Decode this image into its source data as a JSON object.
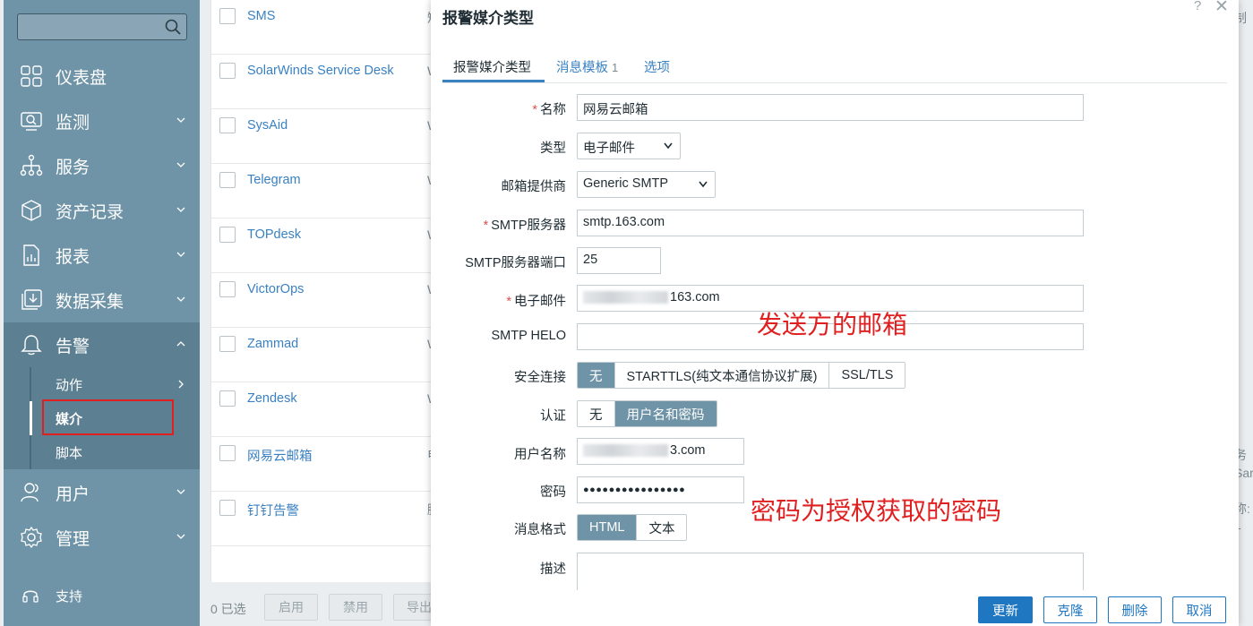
{
  "sidebar": {
    "search_placeholder": "",
    "items": [
      {
        "label": "仪表盘",
        "icon": "dashboard-icon"
      },
      {
        "label": "监测",
        "icon": "monitoring-icon"
      },
      {
        "label": "服务",
        "icon": "services-icon"
      },
      {
        "label": "资产记录",
        "icon": "inventory-icon"
      },
      {
        "label": "报表",
        "icon": "reports-icon"
      },
      {
        "label": "数据采集",
        "icon": "data-collection-icon"
      },
      {
        "label": "告警",
        "icon": "alerts-bell-icon"
      },
      {
        "label": "用户",
        "icon": "users-icon"
      },
      {
        "label": "管理",
        "icon": "administration-gear-icon"
      }
    ],
    "alerts_submenu": [
      {
        "label": "动作"
      },
      {
        "label": "媒介"
      },
      {
        "label": "脚本"
      }
    ],
    "support_label": "支持"
  },
  "list": {
    "rows": [
      {
        "name": "SMS",
        "type": "短"
      },
      {
        "name": "SolarWinds Service Desk",
        "type": "W"
      },
      {
        "name": "SysAid",
        "type": "W"
      },
      {
        "name": "Telegram",
        "type": "W"
      },
      {
        "name": "TOPdesk",
        "type": "W"
      },
      {
        "name": "VictorOps",
        "type": "W"
      },
      {
        "name": "Zammad",
        "type": "W"
      },
      {
        "name": "Zendesk",
        "type": "W"
      },
      {
        "name": "网易云邮箱",
        "type": "电"
      },
      {
        "name": "钉钉告警",
        "type": "脚"
      }
    ],
    "selected_count": "0 已选",
    "footer_buttons": [
      "启用",
      "禁用",
      "导出"
    ],
    "right_clip": [
      "制",
      "务",
      "Sar",
      "称: 1"
    ]
  },
  "modal": {
    "title": "报警媒介类型",
    "help": "?",
    "close": "✕",
    "tabs": [
      {
        "label": "报警媒介类型",
        "badge": ""
      },
      {
        "label": "消息模板",
        "badge": "1"
      },
      {
        "label": "选项",
        "badge": ""
      }
    ],
    "fields": {
      "name_label": "名称",
      "name_value": "网易云邮箱",
      "type_label": "类型",
      "type_value": "电子邮件",
      "provider_label": "邮箱提供商",
      "provider_value": "Generic SMTP",
      "smtp_server_label": "SMTP服务器",
      "smtp_server_value": "smtp.163.com",
      "smtp_port_label": "SMTP服务器端口",
      "smtp_port_value": "25",
      "email_label": "电子邮件",
      "email_value": "163.com",
      "helo_label": "SMTP HELO",
      "helo_value": "",
      "security_label": "安全连接",
      "security_options": [
        "无",
        "STARTTLS(纯文本通信协议扩展)",
        "SSL/TLS"
      ],
      "auth_label": "认证",
      "auth_options": [
        "无",
        "用户名和密码"
      ],
      "username_label": "用户名称",
      "username_value": "3.com",
      "password_label": "密码",
      "password_value": "●●●●●●●●●●●●●●●●",
      "format_label": "消息格式",
      "format_options": [
        "HTML",
        "文本"
      ],
      "description_label": "描述"
    },
    "buttons": {
      "update": "更新",
      "clone": "克隆",
      "delete": "删除",
      "cancel": "取消"
    }
  },
  "annotations": {
    "sender_mailbox": "发送方的邮箱",
    "password_note": "密码为授权获取的密码"
  },
  "colors": {
    "sidebar_bg": "#6f93a7",
    "link": "#3a81c2",
    "primary_button": "#1f77c2",
    "annotation": "#e02020",
    "required_star": "#d9534f"
  }
}
